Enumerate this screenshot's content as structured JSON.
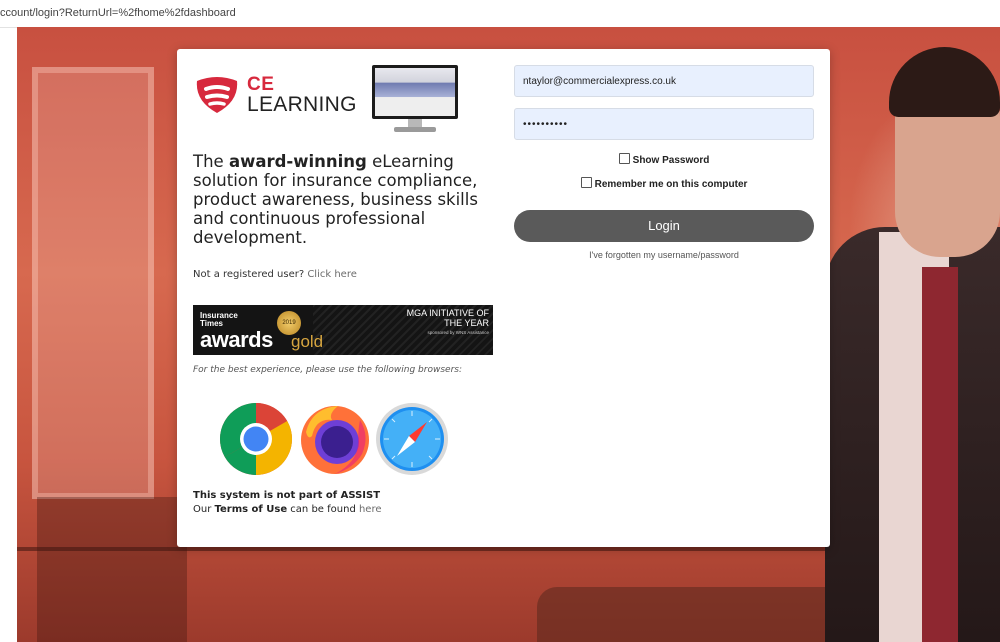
{
  "browser": {
    "url": "ccount/login?ReturnUrl=%2fhome%2fdashboard"
  },
  "brand": {
    "logo_ce": "CE",
    "logo_learning": "LEARNING",
    "accent_color": "#d7293d"
  },
  "tagline": {
    "part1": "The ",
    "bold": "award-winning",
    "part2": " eLearning solution for insurance compliance, product awareness, business skills and continuous professional development."
  },
  "register": {
    "text": "Not a registered user? ",
    "link": "Click here"
  },
  "award": {
    "publisher_line1": "Insurance",
    "publisher_line2": "Times",
    "year": "2019",
    "awards_word": "awards",
    "gold_word": "gold",
    "title_line1": "MGA INITIATIVE OF",
    "title_line2": "THE YEAR",
    "sponsor": "sponsored by WNS Assistance"
  },
  "browsers": {
    "note": "For the best experience, please use the following browsers:",
    "icons": [
      "chrome-icon",
      "firefox-icon",
      "safari-icon"
    ]
  },
  "notice": {
    "assist": "This system is not part of ASSIST",
    "terms_prefix": "Our ",
    "terms_bold": "Terms of Use",
    "terms_middle": " can be found ",
    "terms_link": "here"
  },
  "form": {
    "username_value": "ntaylor@commercialexpress.co.uk",
    "password_value": "••••••••••",
    "show_password_label": "Show Password",
    "remember_label": "Remember me on this computer",
    "login_label": "Login",
    "forgot_label": "I've forgotten my username/password",
    "button_color": "#5a5a5a",
    "field_bg": "#e8f0fe"
  }
}
